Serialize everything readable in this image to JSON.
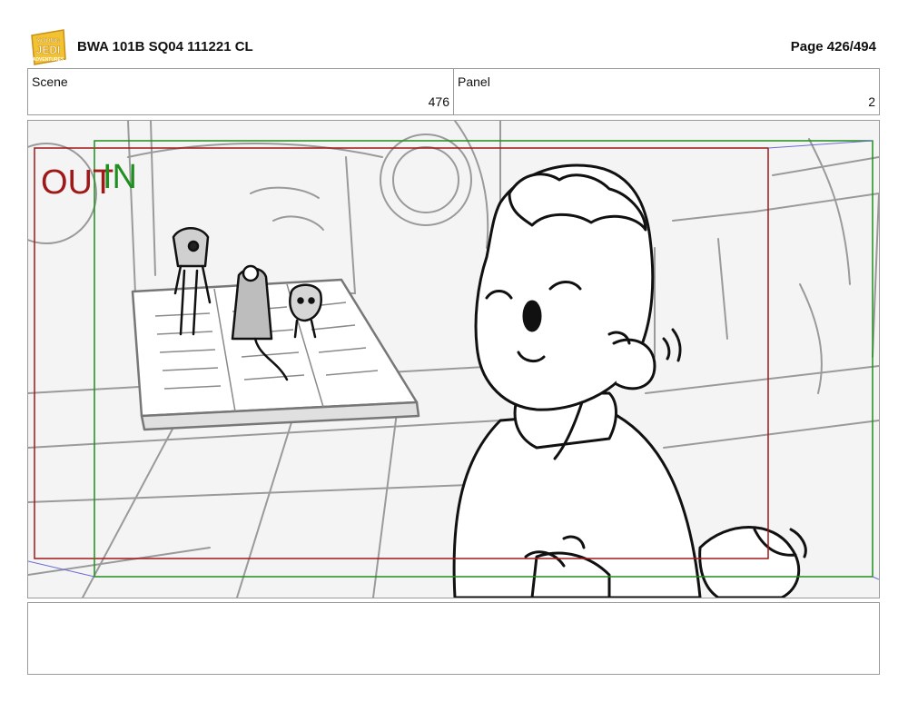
{
  "header": {
    "logo_alt": "YOUNG JEDI ADVENTURES",
    "title": "BWA 101B SQ04 111221 CL",
    "page": "Page 426/494"
  },
  "info": {
    "scene_label": "Scene",
    "scene_value": "476",
    "panel_label": "Panel",
    "panel_value": "2"
  },
  "frame": {
    "out_label": "OUT",
    "in_label": "IN",
    "out_color": "#a01818",
    "in_color": "#1f8f1f"
  },
  "notes": {
    "text": ""
  }
}
